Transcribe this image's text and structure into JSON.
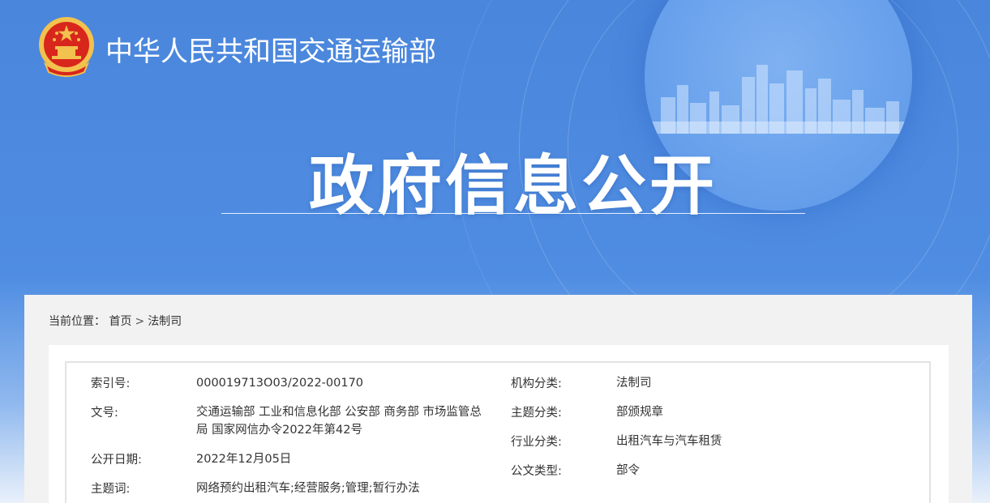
{
  "header": {
    "ministry_name": "中华人民共和国交通运输部",
    "hero_title": "政府信息公开"
  },
  "breadcrumb": {
    "prefix": "当前位置：",
    "home": "首页",
    "separator": ">",
    "current": "法制司"
  },
  "meta": {
    "left": [
      {
        "key": "索引号:",
        "value": "000019713O03/2022-00170"
      },
      {
        "key": "文号:",
        "value": "交通运输部 工业和信息化部 公安部 商务部 市场监管总局 国家网信办令2022年第42号"
      },
      {
        "key": "公开日期:",
        "value": "2022年12月05日"
      },
      {
        "key": "主题词:",
        "value": "网络预约出租汽车;经营服务;管理;暂行办法"
      }
    ],
    "right": [
      {
        "key": "机构分类:",
        "value": "法制司"
      },
      {
        "key": "主题分类:",
        "value": "部颁规章"
      },
      {
        "key": "行业分类:",
        "value": "出租汽车与汽车租赁"
      },
      {
        "key": "公文类型:",
        "value": "部令"
      }
    ]
  },
  "colors": {
    "banner_blue": "#4a86dc",
    "emblem_red": "#d8261c",
    "emblem_gold": "#f2c14e"
  },
  "icons": {
    "emblem": "national-emblem-icon"
  }
}
